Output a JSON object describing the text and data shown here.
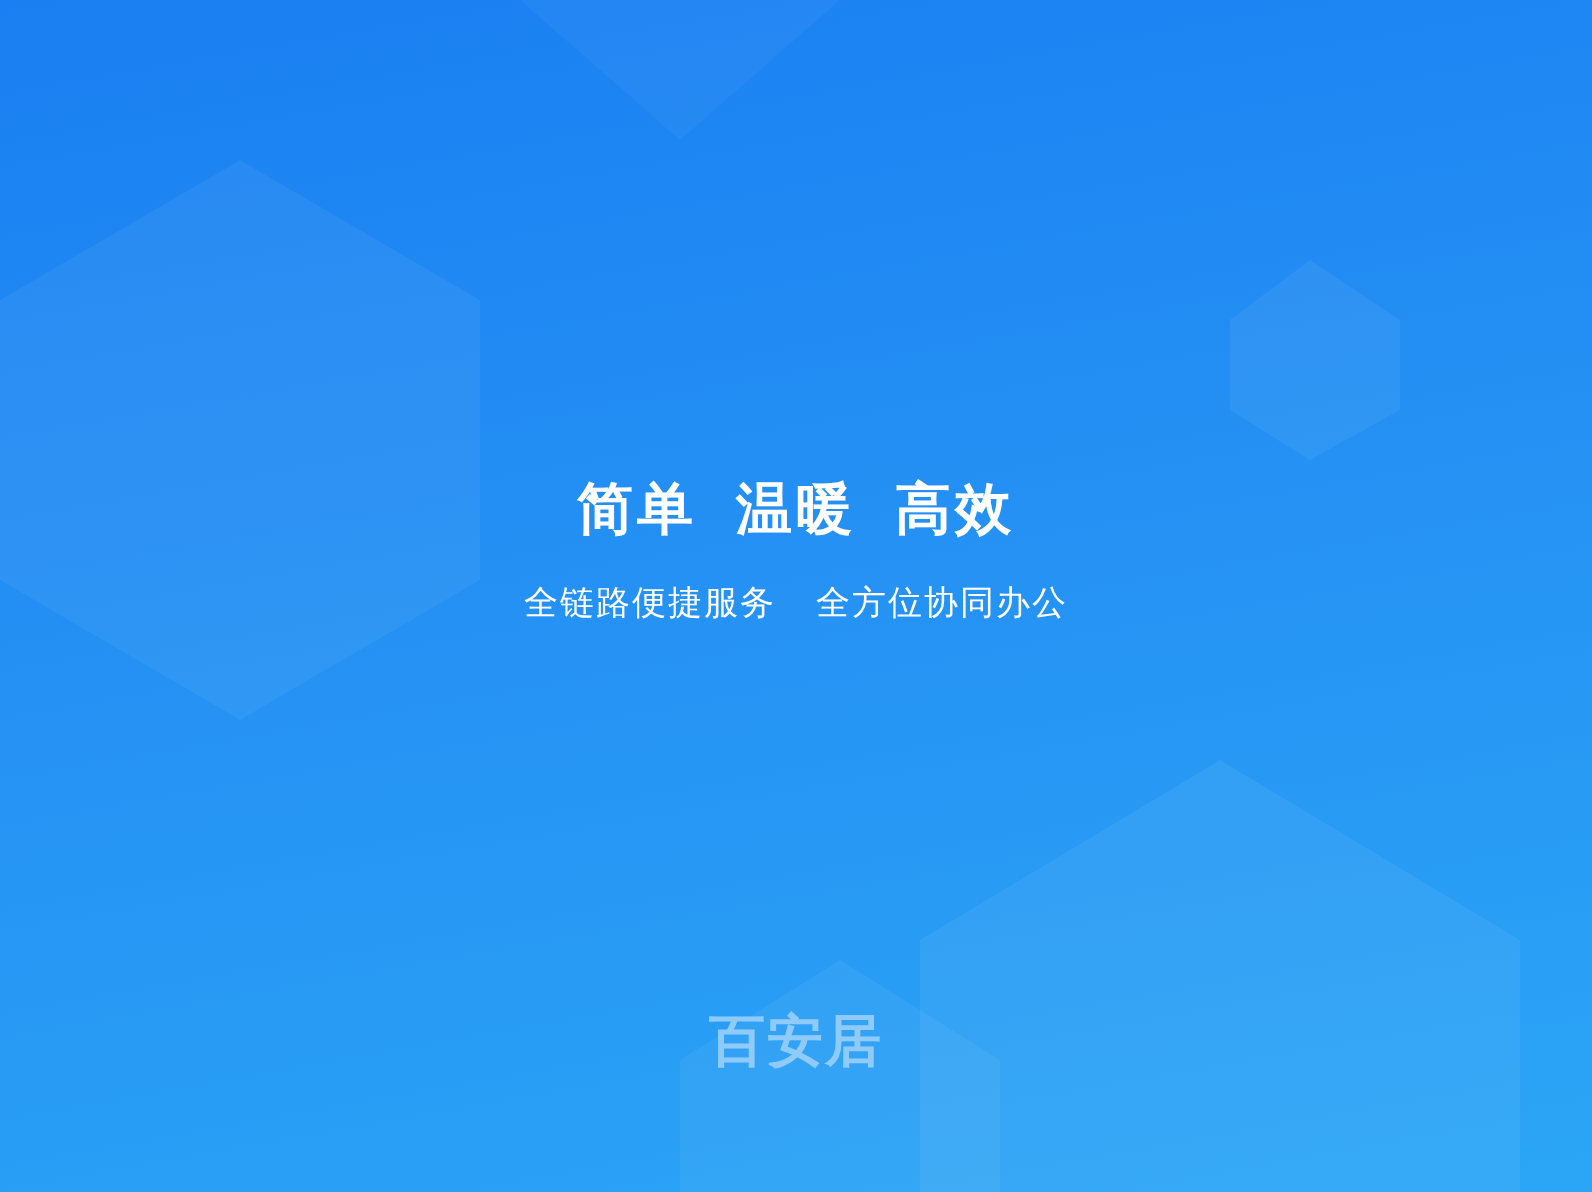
{
  "slogan": {
    "title": [
      "简单",
      "温暖",
      "高效"
    ],
    "subtitle": [
      "全链路便捷服务",
      "全方位协同办公"
    ]
  },
  "logo": {
    "text": "百安居"
  }
}
